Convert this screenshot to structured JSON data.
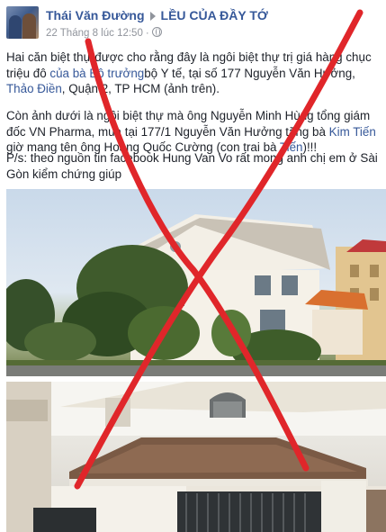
{
  "post": {
    "author": "Thái Văn Đường",
    "group": "LỀU CỦA ĐẦY TỚ",
    "timestamp": "22 Tháng 8 lúc 12:50",
    "separator": "·",
    "paragraph1": {
      "before": "Hai căn biệt thự được cho rằng đây là ngôi biệt thự trị giá hàng chục triệu đô ",
      "link1": "của bà Bộ trưởng",
      "middle": "bộ Y tế, tại số 177 Nguyễn Văn Hưởng, ",
      "link2": "Thảo Điền",
      "after": ", Quận 2, TP HCM (ảnh trên)."
    },
    "paragraph2": {
      "before": "Còn ảnh dưới là ngôi biệt thự mà ông Nguyễn Minh Hùng tổng giám đốc VN Pharma, mua tại 177/1 Nguyễn Văn Hưởng tặng bà ",
      "link1": "Kim Tiến",
      "middle": " giờ mang tên ông Hoàng Quốc Cường (con trai bà ",
      "link2": "Tiến",
      "after": ")!!!"
    },
    "paragraph3": "P/s: theo nguồn tin facebook Hung Van Vo rất mong anh chị em ở Sài Gòn kiểm chứng giúp"
  },
  "colors": {
    "link": "#365899",
    "meta": "#90949c",
    "text": "#1d2129",
    "cross": "#e0262a"
  },
  "icons": {
    "header_arrow": "triangle-right",
    "privacy": "globe"
  }
}
